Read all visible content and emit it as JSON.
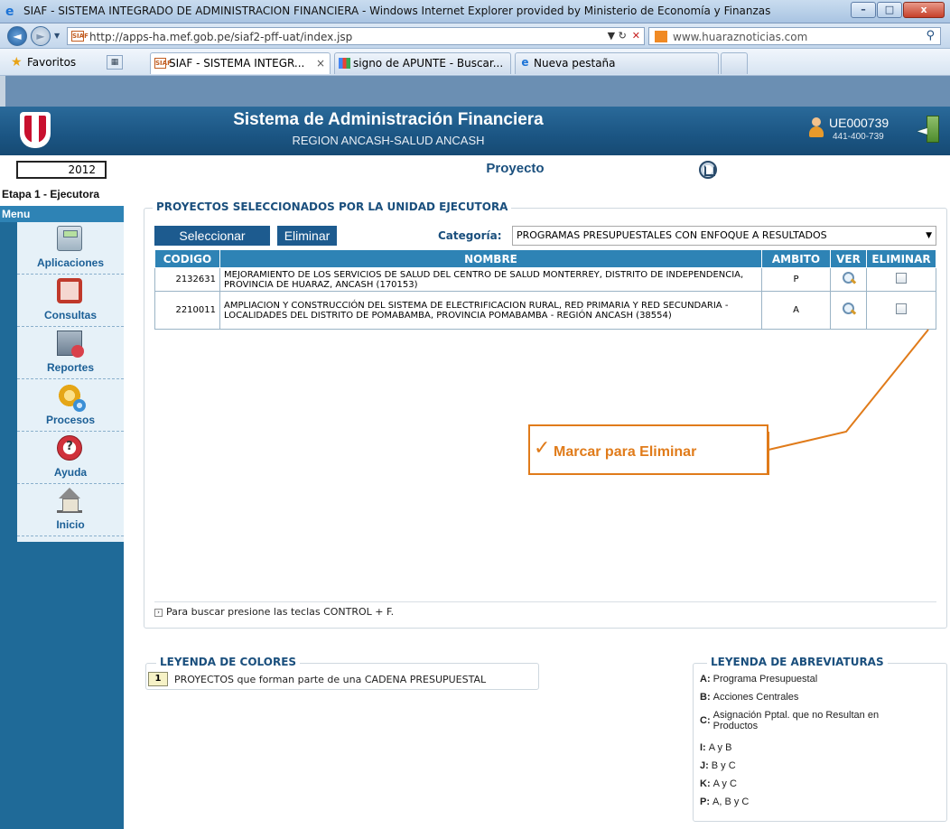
{
  "window": {
    "title": "SIAF - SISTEMA INTEGRADO DE ADMINISTRACION FINANCIERA - Windows Internet Explorer provided by Ministerio de Economía y Finanzas"
  },
  "browser": {
    "url": "http://apps-ha.mef.gob.pe/siaf2-pff-uat/index.jsp",
    "search_text": "www.huaraznoticias.com",
    "favorites_label": "Favoritos",
    "tabs": [
      {
        "label": "SIAF - SISTEMA INTEGR...",
        "close": "×"
      },
      {
        "label": "signo de APUNTE - Buscar..."
      },
      {
        "label": "Nueva pestaña"
      }
    ]
  },
  "header": {
    "title": "Sistema de Administración Financiera",
    "subtitle": "REGION ANCASH-SALUD ANCASH",
    "user_code": "UE000739",
    "user_phone": "441-400-739"
  },
  "sidebar": {
    "year": "2012",
    "etapa": "Etapa 1 - Ejecutora",
    "menu_title": "Menu",
    "items": [
      {
        "label": "Aplicaciones",
        "icon": "calculator-icon"
      },
      {
        "label": "Consultas",
        "icon": "magnifier-icon"
      },
      {
        "label": "Reportes",
        "icon": "report-icon"
      },
      {
        "label": "Procesos",
        "icon": "gears-icon"
      },
      {
        "label": "Ayuda",
        "icon": "help-icon"
      },
      {
        "label": "Inicio",
        "icon": "house-icon"
      }
    ]
  },
  "main": {
    "title": "Proyecto",
    "section_title": "PROYECTOS SELECCIONADOS POR LA UNIDAD EJECUTORA",
    "buttons": {
      "seleccionar": "Seleccionar",
      "eliminar": "Eliminar"
    },
    "category_label": "Categoría:",
    "category_value": "PROGRAMAS PRESUPUESTALES CON ENFOQUE A RESULTADOS",
    "columns": [
      "CODIGO",
      "NOMBRE",
      "AMBITO",
      "VER",
      "ELIMINAR"
    ],
    "rows": [
      {
        "codigo": "2132631",
        "nombre": "MEJORAMIENTO DE LOS SERVICIOS DE SALUD DEL CENTRO DE SALUD MONTERREY, DISTRITO DE INDEPENDENCIA, PROVINCIA DE HUARAZ, ANCASH (170153)",
        "ambito": "P"
      },
      {
        "codigo": "2210011",
        "nombre": "AMPLIACION Y CONSTRUCCIÓN DEL SISTEMA DE ELECTRIFICACION RURAL, RED PRIMARIA Y RED SECUNDARIA - LOCALIDADES DEL DISTRITO DE POMABAMBA, PROVINCIA POMABAMBA - REGIÓN ANCASH (38554)",
        "ambito": "A"
      }
    ],
    "search_hint": "Para buscar presione las teclas CONTROL + F.",
    "callout": "Marcar para Eliminar"
  },
  "legend_colors": {
    "title": "LEYENDA DE COLORES",
    "num": "1",
    "desc": "PROYECTOS que forman parte de una CADENA PRESUPUESTAL"
  },
  "legend_abbrev": {
    "title": "LEYENDA DE ABREVIATURAS",
    "items": [
      {
        "k": "A:",
        "v": "Programa Presupuestal"
      },
      {
        "k": "B:",
        "v": "Acciones Centrales"
      },
      {
        "k": "C:",
        "v": "Asignación Pptal. que no Resultan en Productos"
      },
      {
        "k": "I:",
        "v": "A y B"
      },
      {
        "k": "J:",
        "v": "B y C"
      },
      {
        "k": "K:",
        "v": "A y C"
      },
      {
        "k": "P:",
        "v": "A, B y C"
      }
    ]
  }
}
